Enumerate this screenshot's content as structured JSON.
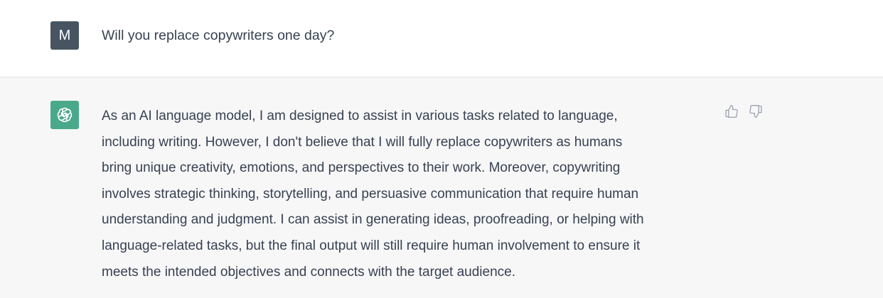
{
  "user_message": {
    "avatar_letter": "M",
    "text": "Will you replace copywriters one day?"
  },
  "assistant_message": {
    "avatar_icon": "openai-logo-icon",
    "lines": [
      "As an AI language model, I am designed to assist in various tasks related to language,",
      "including writing. However, I don't believe that I will fully replace copywriters as humans",
      "bring unique creativity, emotions, and perspectives to their work. Moreover, copywriting",
      "involves strategic thinking, storytelling, and persuasive communication that require human",
      "understanding and judgment. I can assist in generating ideas, proofreading, or helping with",
      "language-related tasks, but the final output will still require human involvement to ensure it",
      "meets the intended objectives and connects with the target audience."
    ]
  },
  "feedback": {
    "thumbs_up_icon": "thumbs-up-icon",
    "thumbs_down_icon": "thumbs-down-icon"
  },
  "colors": {
    "user_avatar_bg": "#465561",
    "assistant_avatar_bg": "#4aa98a",
    "assistant_row_bg": "#f7f7f8",
    "text": "#374151",
    "icon": "#9ca3af"
  }
}
